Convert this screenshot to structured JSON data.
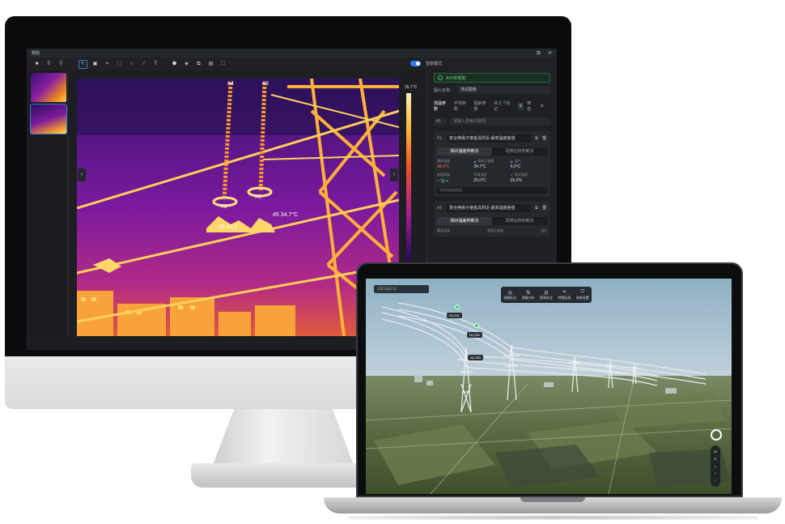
{
  "monitor": {
    "window_title": "帮助",
    "window_controls": [
      "⧉",
      "✕"
    ],
    "toolbar": {
      "tools": [
        "pointer-icon",
        "crop-icon",
        "target-icon",
        "box-icon",
        "circle-icon",
        "line-icon",
        "text-icon",
        "fill-icon",
        "tag-icon",
        "layers-icon",
        "grid-icon",
        "fullscreen-icon"
      ],
      "tool_glyphs": [
        "↖",
        "▣",
        "⌖",
        "⬚",
        "○",
        "⟋",
        "T",
        "⬢",
        "◈",
        "⧉",
        "▤",
        "⛶"
      ],
      "view_modes": [
        "■",
        "⠿",
        "⠿"
      ],
      "toggle_label": "智能模式",
      "toggle_on": true
    },
    "viewer": {
      "labels": [
        "#4",
        "#3",
        "#2",
        "#1",
        "#5 34.7°C",
        "#6 43.2"
      ],
      "prev": "‹",
      "next": "›"
    },
    "scale_max": "35.7°C",
    "panel": {
      "ai_label": "AI分析帮助",
      "image_name_label": "图片名称：",
      "image_name_value": "测试图像",
      "tabs": [
        "测温参数",
        "环境参数",
        "辐射参数",
        "共 5 个标记"
      ],
      "active_tab": 0,
      "tab_extra": "筛选",
      "search_number": "#1",
      "search_placeholder": "请输入搜索关键词",
      "cards": [
        {
          "index": "#1",
          "name": "复合绝缘子接金具附近-最高温度差值",
          "segments": [
            "相对温差判断法",
            "同类比较判断法"
          ],
          "metrics": [
            {
              "label": "最高温度",
              "value": "38.3°C",
              "tone": "hot"
            },
            {
              "label": "参照点温度",
              "value": "34.7°C",
              "tone": "normal"
            },
            {
              "label": "温升",
              "value": "4.0°C",
              "tone": "normal"
            },
            {
              "label": "缺陷等级",
              "value": "一般 ▾",
              "tone": "ok"
            },
            {
              "label": "环境温度",
              "value": "25.0°C",
              "tone": "normal"
            },
            {
              "label": "相对温差",
              "value": "29.2%",
              "tone": "normal"
            }
          ],
          "footer": "请选择缺陷描述"
        },
        {
          "index": "#2",
          "name": "复合绝缘子接金具附近-最高温度差值",
          "segments": [
            "相对温差判断法",
            "同类比较判断法"
          ],
          "metric_labels": [
            "最高温度",
            "参照点温度",
            "温升"
          ]
        }
      ]
    }
  },
  "laptop": {
    "search_placeholder": "搜索线路杆塔",
    "toolbar": [
      {
        "icon": "locate-icon",
        "glyph": "◎",
        "label": "线路标记"
      },
      {
        "icon": "measure-icon",
        "glyph": "⇅",
        "label": "测量分析"
      },
      {
        "icon": "clearance-icon",
        "glyph": "⊡",
        "label": "距离安全"
      },
      {
        "icon": "pin-icon",
        "glyph": "⌖",
        "label": "特殊区段"
      },
      {
        "icon": "shield-icon",
        "glyph": "⛉",
        "label": "系统设置"
      }
    ],
    "tower_labels": [
      "N1,001",
      "N1,002",
      "N1,003"
    ],
    "side_controls": [
      "3D",
      "⟳",
      "⌂",
      "+",
      "−"
    ]
  }
}
